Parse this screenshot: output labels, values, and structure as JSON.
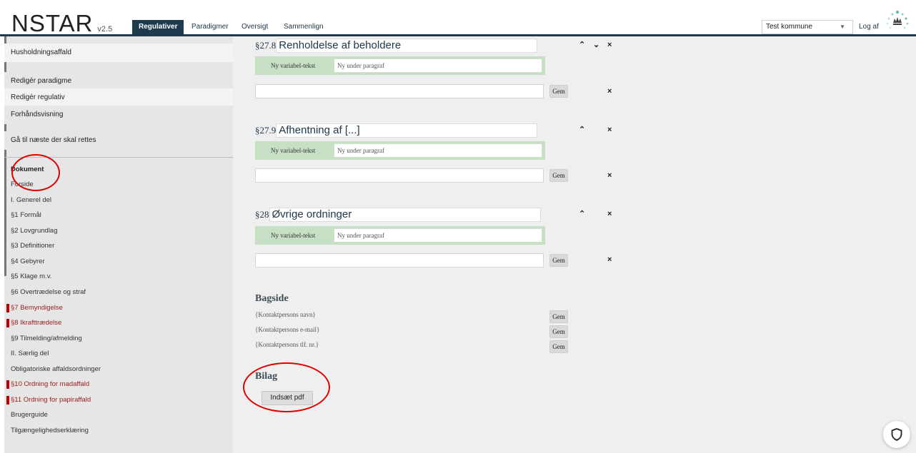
{
  "app": {
    "name": "NSTAR",
    "version": "v2.5"
  },
  "nav": {
    "tabs": [
      "Regulativer",
      "Paradigmer",
      "Oversigt",
      "Sammenlign"
    ],
    "active": "Regulativer"
  },
  "header": {
    "kommune": "Test kommune",
    "logout": "Log af"
  },
  "sidebar": {
    "top_items": [
      "Husholdningsaffald",
      "Redigér paradigme",
      "Redigér regulativ",
      "Forhåndsvisning",
      "Gå til næste der skal rettes"
    ],
    "section_heading": "Dokument",
    "items": [
      {
        "label": "Forside",
        "flag": false
      },
      {
        "label": "I. Generel del",
        "flag": false
      },
      {
        "label": "§1 Formål",
        "flag": false
      },
      {
        "label": "§2 Lovgrundlag",
        "flag": false
      },
      {
        "label": "§3 Definitioner",
        "flag": false
      },
      {
        "label": "§4 Gebyrer",
        "flag": false
      },
      {
        "label": "§5 Klage m.v.",
        "flag": false
      },
      {
        "label": "§6 Overtrædelse og straf",
        "flag": false
      },
      {
        "label": "§7 Bemyndigelse",
        "flag": true
      },
      {
        "label": "§8 Ikrafttrædelse",
        "flag": true
      },
      {
        "label": "§9 Tilmelding/afmelding",
        "flag": false
      },
      {
        "label": "II. Særlig del",
        "flag": false
      },
      {
        "label": "Obligatoriske affaldsordninger",
        "flag": false
      },
      {
        "label": "§10 Ordning for madaffald",
        "flag": true
      },
      {
        "label": "§11 Ordning for papiraffald",
        "flag": true
      },
      {
        "label": "Brugerguide",
        "flag": false
      },
      {
        "label": "Tilgængelighedserklæring",
        "flag": false
      }
    ]
  },
  "sections": [
    {
      "number": "§27.8",
      "title": "Renholdelse af beholdere",
      "var_label": "Ny variabel-tekst",
      "var_placeholder": "Ny under paragraf",
      "gem": "Gem",
      "controls": [
        "⌃",
        "⌄",
        "×"
      ]
    },
    {
      "number": "§27.9",
      "title": "Afhentning af [...]",
      "var_label": "Ny variabel-tekst",
      "var_placeholder": "Ny under paragraf",
      "gem": "Gem",
      "controls": [
        "⌃",
        "×"
      ]
    },
    {
      "number": "§28",
      "title": "Øvrige ordninger",
      "var_label": "Ny variabel-tekst",
      "var_placeholder": "Ny under paragraf",
      "gem": "Gem",
      "controls": [
        "⌃",
        "×"
      ]
    }
  ],
  "bagside": {
    "heading": "Bagside",
    "rows": [
      {
        "text": "{Kontaktpersons navn}",
        "gem": "Gem"
      },
      {
        "text": "{Kontaktpersons e-mail}",
        "gem": "Gem"
      },
      {
        "text": "{Kontaktpersons tlf. nr.}",
        "gem": "Gem"
      }
    ]
  },
  "bilag": {
    "heading": "Bilag",
    "button": "Indsæt pdf"
  },
  "colors": {
    "navy": "#1f3a4c",
    "flag_red": "#c00000",
    "annotation_red": "#e00000",
    "green_band": "#c7dfc4"
  }
}
